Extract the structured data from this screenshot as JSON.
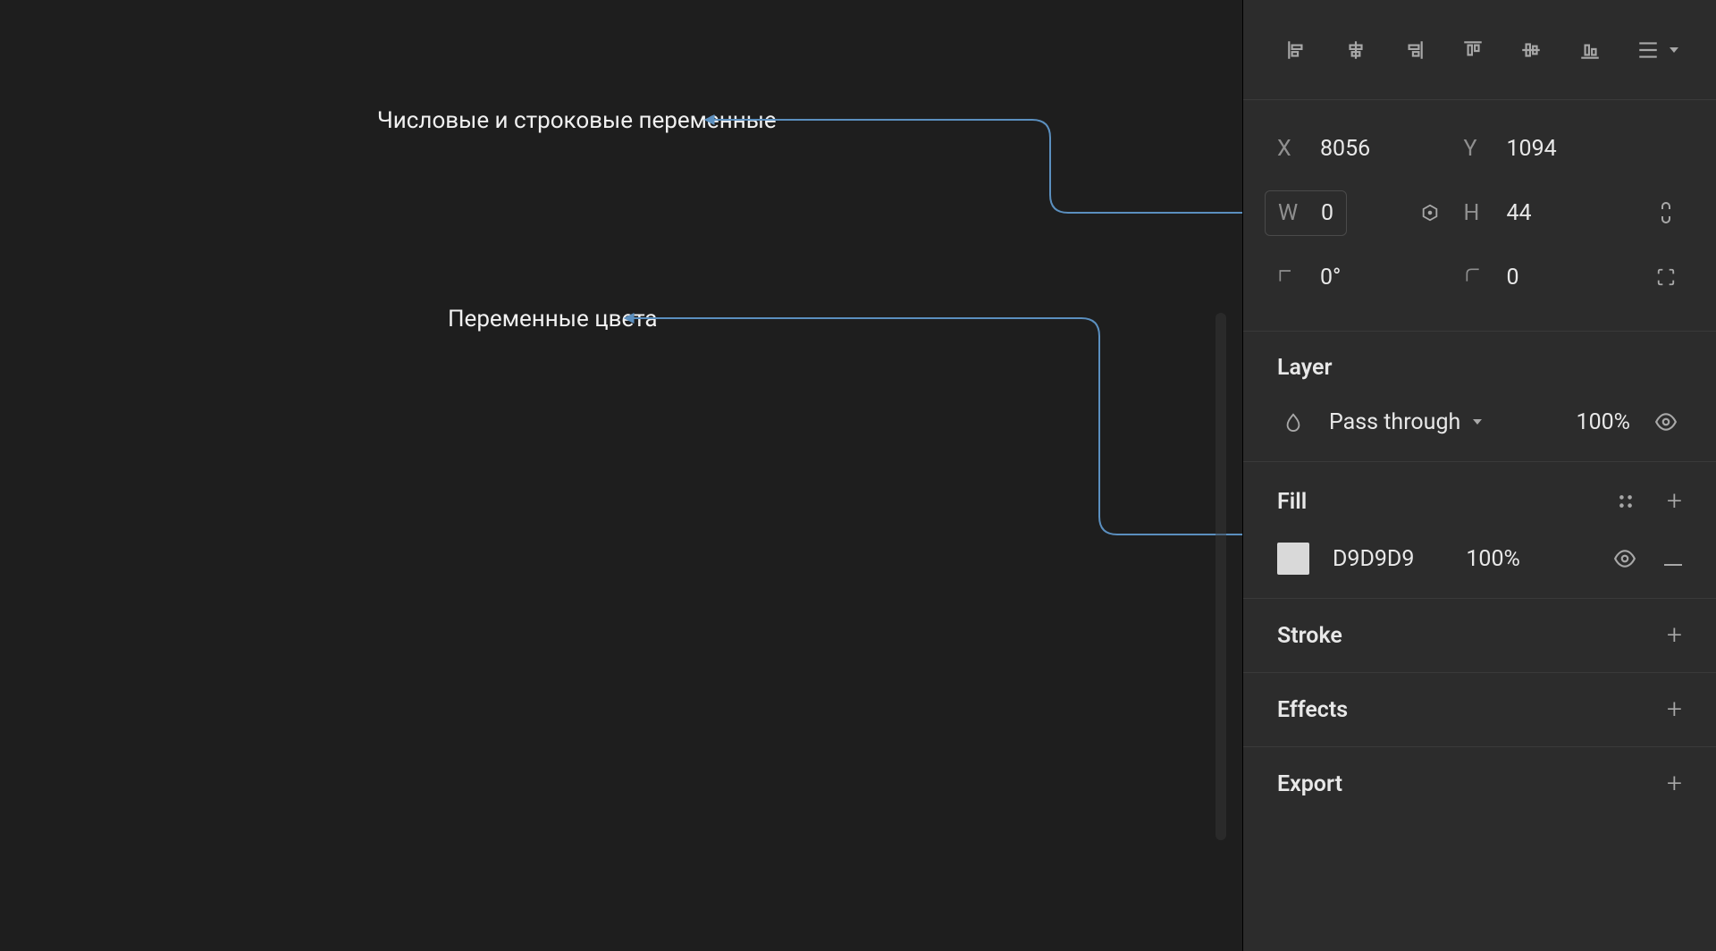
{
  "annotations": {
    "numeric_string_vars": "Числовые и строковые переменные",
    "color_vars": "Переменные цвета"
  },
  "design": {
    "x_label": "X",
    "x": "8056",
    "y_label": "Y",
    "y": "1094",
    "w_label": "W",
    "w": "0",
    "h_label": "H",
    "h": "44",
    "rot_label": "",
    "rot": "0°",
    "corner_label": "",
    "corner": "0"
  },
  "layer": {
    "title": "Layer",
    "blend": "Pass through",
    "opacity": "100%"
  },
  "fill": {
    "title": "Fill",
    "hex": "D9D9D9",
    "opacity": "100%"
  },
  "stroke": {
    "title": "Stroke"
  },
  "effects": {
    "title": "Effects"
  },
  "export": {
    "title": "Export"
  }
}
